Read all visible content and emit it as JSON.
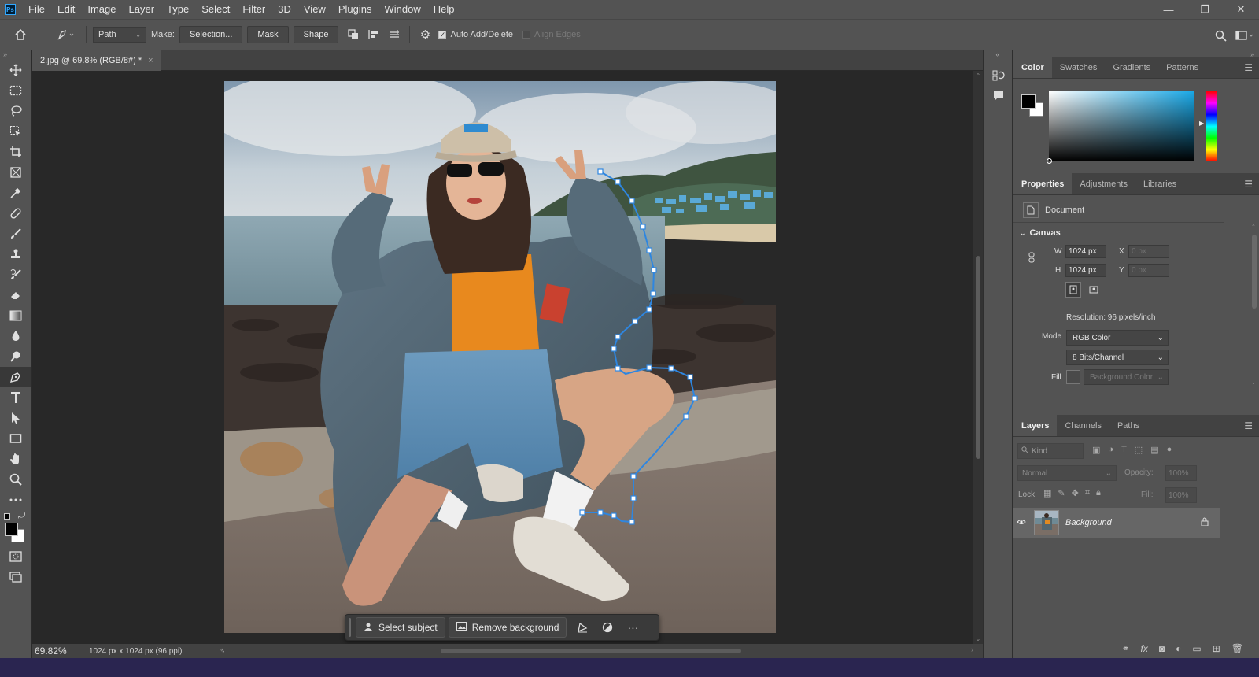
{
  "menubar": {
    "items": [
      "File",
      "Edit",
      "Image",
      "Layer",
      "Type",
      "Select",
      "Filter",
      "3D",
      "View",
      "Plugins",
      "Window",
      "Help"
    ],
    "logo": "Ps",
    "window_controls": [
      "—",
      "❐",
      "✕"
    ]
  },
  "options": {
    "mode_value": "Path",
    "make_label": "Make:",
    "selection_label": "Selection...",
    "mask_label": "Mask",
    "shape_label": "Shape",
    "auto_add_delete": "Auto Add/Delete",
    "align_edges": "Align Edges"
  },
  "document": {
    "tab_title": "2.jpg @ 69.8% (RGB/8#) *",
    "close": "×"
  },
  "taskbar": {
    "select_subject": "Select subject",
    "remove_background": "Remove background",
    "more": "···"
  },
  "status": {
    "zoom": "69.82%",
    "info": "1024 px x 1024 px (96 ppi)",
    "chevron": "›"
  },
  "color_panel": {
    "tabs": [
      "Color",
      "Swatches",
      "Gradients",
      "Patterns"
    ],
    "foreground": "#000000",
    "background": "#ffffff"
  },
  "properties_panel": {
    "tabs": [
      "Properties",
      "Adjustments",
      "Libraries"
    ],
    "doc_label": "Document",
    "canvas_title": "Canvas",
    "w_label": "W",
    "h_label": "H",
    "x_label": "X",
    "y_label": "Y",
    "w_value": "1024 px",
    "h_value": "1024 px",
    "x_value": "0 px",
    "y_value": "0 px",
    "resolution": "Resolution: 96 pixels/inch",
    "mode_label": "Mode",
    "mode_value": "RGB Color",
    "bits_value": "8 Bits/Channel",
    "fill_label": "Fill",
    "fill_value": "Background Color"
  },
  "layers_panel": {
    "tabs": [
      "Layers",
      "Channels",
      "Paths"
    ],
    "kind_placeholder": "Kind",
    "blend_mode": "Normal",
    "opacity_label": "Opacity:",
    "opacity_value": "100%",
    "lock_label": "Lock:",
    "fill_label": "Fill:",
    "fill_value": "100%",
    "layer_name": "Background"
  }
}
